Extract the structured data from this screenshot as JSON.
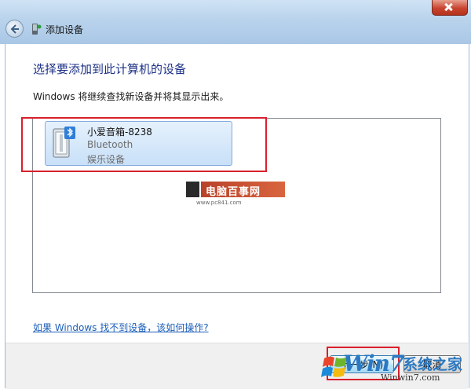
{
  "window": {
    "title": "添加设备"
  },
  "main": {
    "heading": "选择要添加到此计算机的设备",
    "subtext": "Windows 将继续查找新设备并将其显示出来。",
    "help_link": "如果 Windows 找不到设备，该如何操作?"
  },
  "devices": [
    {
      "name": "小爱音箱-8238",
      "type": "Bluetooth",
      "category": "娱乐设备",
      "icon": "speaker-device-icon"
    }
  ],
  "watermark": {
    "title": "电脑百事网",
    "url": "www.pc841.com"
  },
  "footer": {
    "next_label": "下一步(N)",
    "cancel_label": "取消"
  },
  "brand_watermark": {
    "text": "Win7",
    "cn": "系统之家",
    "url": "Winwin7.com"
  },
  "colors": {
    "heading": "#1e3287",
    "link": "#1c5fb8",
    "highlight_box": "#d8202b",
    "selected_tile": "#c8e0f8"
  }
}
